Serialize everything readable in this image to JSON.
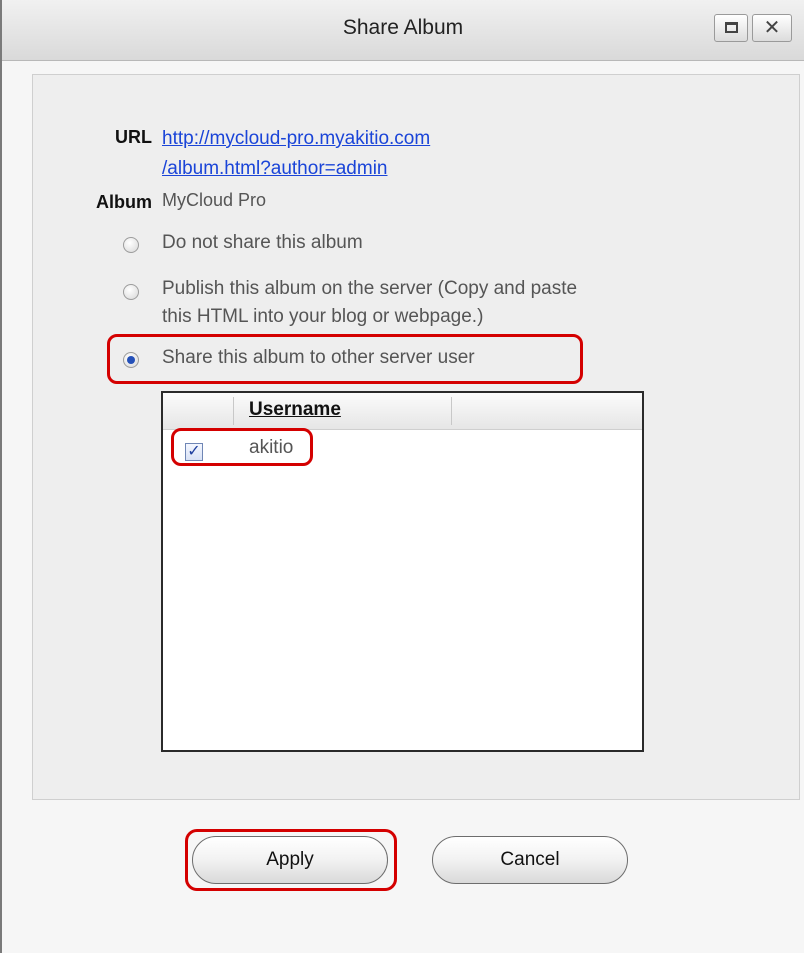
{
  "window": {
    "title": "Share Album",
    "close_glyph": "✕"
  },
  "form": {
    "url_label": "URL",
    "url_line1": "http://mycloud-pro.myakitio.com",
    "url_line2": "/album.html?author=admin",
    "album_label": "Album",
    "album_value": "MyCloud Pro"
  },
  "sharing": {
    "options": [
      {
        "label": "Do not share this album",
        "selected": false
      },
      {
        "label_line1": "Publish this album on the server (Copy and paste",
        "label_line2": "this HTML into your blog or webpage.)",
        "selected": false
      },
      {
        "label": "Share this album to other server user",
        "selected": true
      }
    ]
  },
  "user_list": {
    "column_header": "Username",
    "rows": [
      {
        "username": "akitio",
        "checked": true,
        "check_glyph": "✓"
      }
    ]
  },
  "buttons": {
    "apply": "Apply",
    "cancel": "Cancel"
  },
  "colors": {
    "link": "#1a44d8",
    "highlight": "#d40000",
    "radio_selected": "#2450b8"
  },
  "icons": {
    "maximize": "maximize-icon",
    "close": "close-icon",
    "checkbox": "checkmark-icon"
  }
}
